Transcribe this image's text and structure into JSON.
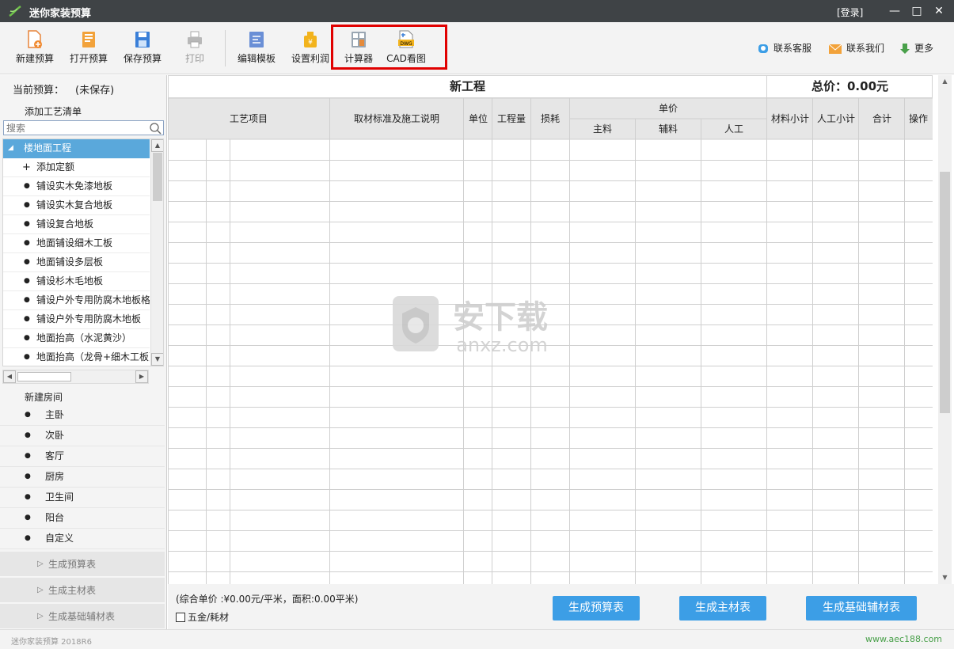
{
  "window": {
    "title": "迷你家装预算",
    "login": "[登录]",
    "minimize": "—",
    "maximize": "□",
    "close": "✕"
  },
  "toolbar": {
    "new_budget": "新建预算",
    "open_budget": "打开预算",
    "save_budget": "保存预算",
    "print": "打印",
    "edit_template": "编辑模板",
    "set_profit": "设置利润",
    "calculator": "计算器",
    "cad_view": "CAD看图",
    "cad_badge": "DWG",
    "contact_service": "联系客服",
    "contact_us": "联系我们",
    "more": "更多"
  },
  "sidebar": {
    "current_label": "当前预算：",
    "current_value": "(未保存)",
    "add_process_title": "添加工艺清单",
    "search_placeholder": "搜索",
    "tree": [
      "楼地面工程",
      "添加定额",
      "铺设实木免漆地板",
      "铺设实木复合地板",
      "铺设复合地板",
      "地面铺设细木工板",
      "地面铺设多层板",
      "铺设杉木毛地板",
      "铺设户外专用防腐木地板格",
      "铺设户外专用防腐木地板",
      "地面抬高（水泥黄沙）",
      "地面抬高（龙骨+细木工板）"
    ],
    "new_room_title": "新建房间",
    "rooms": [
      "主卧",
      "次卧",
      "客厅",
      "厨房",
      "卫生间",
      "阳台",
      "自定义"
    ],
    "generate": [
      "生成预算表",
      "生成主材表",
      "生成基础辅材表"
    ]
  },
  "main": {
    "project_title": "新工程",
    "total_label": "总价：0.00元",
    "columns": {
      "craft": "工艺项目",
      "standard": "取材标准及施工说明",
      "unit": "单位",
      "quantity": "工程量",
      "loss": "损耗",
      "unit_price": "单价",
      "main_material": "主料",
      "aux_material": "辅料",
      "labor": "人工",
      "material_subtotal": "材料小计",
      "labor_subtotal": "人工小计",
      "total": "合计",
      "action": "操作"
    },
    "watermark": "安下载",
    "watermark_sub": "anxz.com"
  },
  "footer": {
    "summary": "(综合单价 :¥0.00元/平米，面积:0.00平米)",
    "hardware_checkbox": "五金/耗材",
    "hardware_checked": false,
    "btn_budget": "生成预算表",
    "btn_main": "生成主材表",
    "btn_aux": "生成基础辅材表"
  },
  "status": {
    "version": "迷你家装预算 2018R6",
    "website": "www.aec188.com"
  },
  "colors": {
    "titlebar": "#3f4346",
    "accent": "#3c9ee6",
    "selected": "#5aa8db",
    "highlight": "#e00000",
    "link_green": "#49a04a"
  }
}
